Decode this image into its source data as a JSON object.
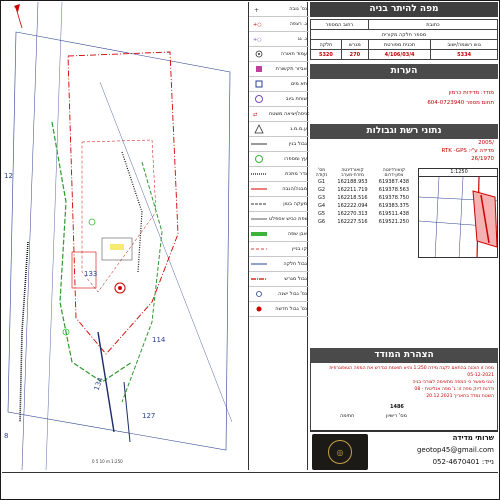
{
  "title_block": {
    "main_title": "מפה להיתר בניה",
    "street_label": "רחוב המספר",
    "address_label": "כתובת",
    "gush_label": "גוש רשומה/ישוב",
    "helka_label": "מגרש",
    "plan_label": "תכנית מפורטת",
    "parcel_label": "חלקה",
    "gush_value": "5334",
    "plan_value": "4/106/03/4",
    "helka_value": "270",
    "parcel_value": "5320",
    "sub_label": "מספר חלקה מקורית"
  },
  "notes": {
    "header": "הערות",
    "line1": "מודד: מדידות כרמון",
    "line2": "604-0723940 תחום מספר",
    "line3": "2005/",
    "line4": "RTK -GPS :מדידה ע\"י",
    "line5": "26/1970"
  },
  "section_headers": {
    "network": "נתוני רשת וגבולות",
    "declaration": "הצהרת המודד"
  },
  "coordinates": {
    "col_point": "מס' נקודה",
    "col_east": "קואורדינטה מזרח-מערב",
    "col_north": "קואורדינטה צפון-דרום",
    "rows": [
      {
        "point": "G1",
        "east": "162188.953",
        "north": "619387.438"
      },
      {
        "point": "G2",
        "east": "162211.719",
        "north": "619378.563"
      },
      {
        "point": "G3",
        "east": "162218.516",
        "north": "619378.750"
      },
      {
        "point": "G4",
        "east": "162222.094",
        "north": "619383.375"
      },
      {
        "point": "G5",
        "east": "162270.313",
        "north": "619511.438"
      },
      {
        "point": "G6",
        "east": "162227.516",
        "north": "619521.250"
      }
    ]
  },
  "mini_map": {
    "scale": "1:1250"
  },
  "declaration": {
    "line1": "מפה זו הוכנה בהתאם לקנה מידה 1:250 והיא תואמת כנדרש את המפה הטופוגרפית",
    "line2": "05-12-2021",
    "line3": "הנני מאשר כי המפה מתאימה לצורכי בניה",
    "line4": "ודרגת דיוק מפה זו: ג' מפה אנליטית - 08",
    "line5": "השטח נמדד בתאריך  20.12.2021  ",
    "sign_number": "1486",
    "sign_label": "מס' רישיון",
    "sign_name": "חתימה"
  },
  "legend": {
    "items": [
      {
        "label": "נס' גובה",
        "icon": "elevation-point-icon"
      },
      {
        "label": "ג. רצפה",
        "icon": "floor-level-icon"
      },
      {
        "label": "ג. גג",
        "icon": "roof-level-icon"
      },
      {
        "label": "עמוד תאורה",
        "icon": "light-pole-icon"
      },
      {
        "label": "אביזר תקשורת",
        "icon": "telecom-box-icon"
      },
      {
        "label": "תא מים",
        "icon": "water-box-icon"
      },
      {
        "label": "שוחת ביוב",
        "icon": "sewer-manhole-icon"
      },
      {
        "label": "כניסה/יציאה משטח",
        "icon": "entrance-icon"
      },
      {
        "label": "ע.מ.מ.ג",
        "icon": "marker-icon"
      },
      {
        "label": "גבול בנין",
        "icon": "building-line-icon"
      },
      {
        "label": "עץ ומספרו",
        "icon": "tree-icon"
      },
      {
        "label": "גדר מתכת",
        "icon": "metal-fence-icon"
      },
      {
        "label": "מבנה/הגבה",
        "icon": "structure-icon"
      },
      {
        "label": "מעקה בטון",
        "icon": "concrete-rail-icon"
      },
      {
        "label": "שפת כביש אספלט",
        "icon": "asphalt-edge-icon"
      },
      {
        "label": "אבן שפה",
        "icon": "curb-icon"
      },
      {
        "label": "קו בניין",
        "icon": "setback-line-icon"
      },
      {
        "label": "גבול חלקה",
        "icon": "parcel-line-icon"
      },
      {
        "label": "גבול מגרש",
        "icon": "lot-line-icon"
      },
      {
        "label": "נס' גבול ישנה",
        "icon": "old-boundary-icon"
      },
      {
        "label": "נס' גבול חדשה",
        "icon": "new-boundary-icon"
      }
    ]
  },
  "map_labels": {
    "lot_number": "133",
    "parcel_a": "114",
    "parcel_b": "134",
    "parcel_c": "127",
    "edge_a": "12",
    "edge_b": "8",
    "scale_text": "0 5 10 m 1:250"
  },
  "footer": {
    "company": "שרותי מדידה",
    "email": "geotop45@gmail.com",
    "phone": "052-4670401 :נייד"
  },
  "colors": {
    "header_bg": "#3f3f3f",
    "red_accent": "#c00000",
    "lot_outline": "#d00000",
    "road_green": "#2e9a2e",
    "tree_green": "#3cb43c",
    "boundary_blue": "#2a3f8f",
    "logo_gold": "#c7a04a"
  }
}
